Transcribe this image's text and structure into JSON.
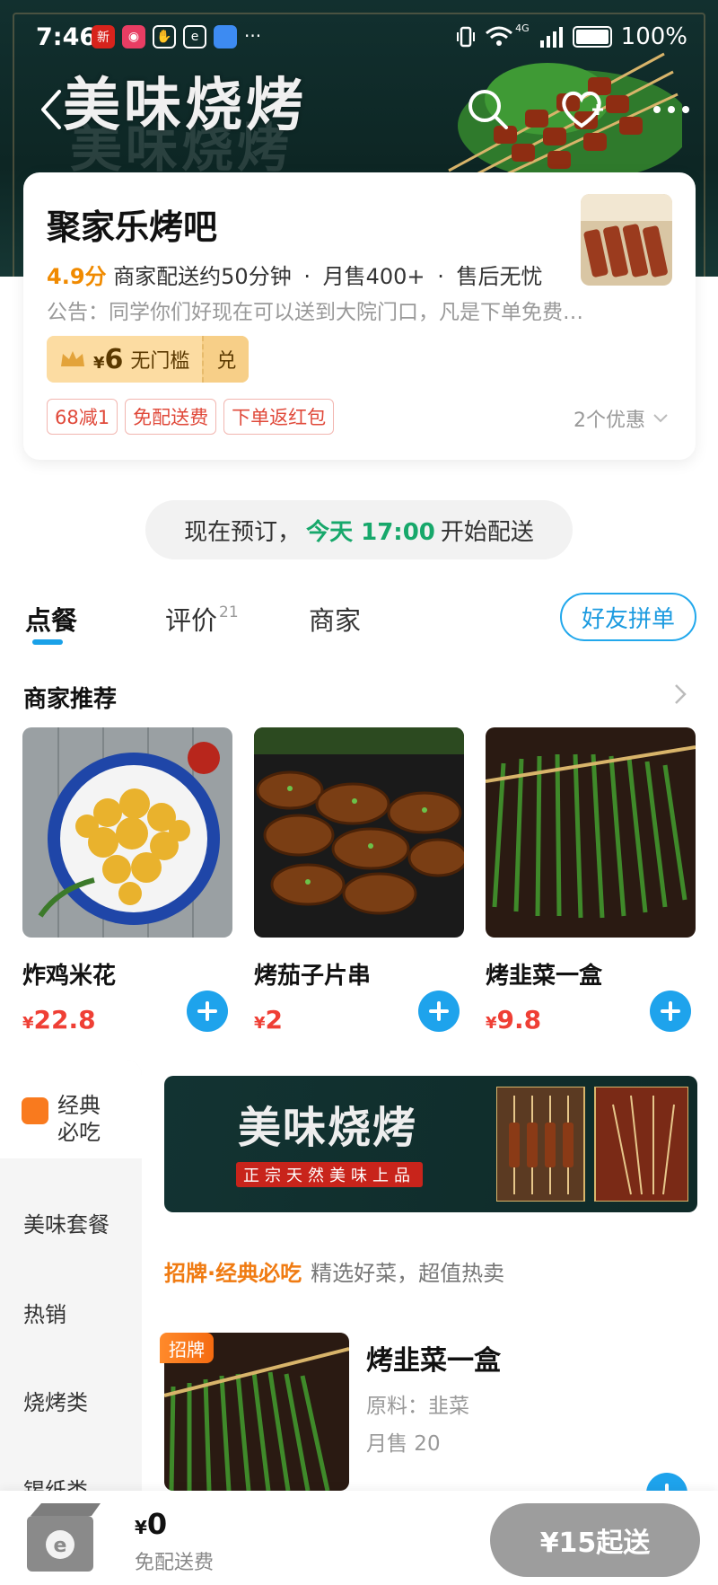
{
  "status_bar": {
    "time": "7:46",
    "battery_text": "100%",
    "battery_level": 1.0,
    "network_label": "4G",
    "more_dots": "···"
  },
  "header": {
    "banner_title": "美味烧烤",
    "icons": [
      "back-icon",
      "search-icon",
      "favorite-icon",
      "more-icon"
    ]
  },
  "shop": {
    "name": "聚家乐烤吧",
    "rating": "4.9分",
    "delivery_time": "商家配送约50分钟",
    "monthly_sales": "月售400+",
    "after_sale": "售后无忧",
    "separator": "·",
    "notice": "公告：同学你们好现在可以送到大院门口，凡是下单免费…",
    "coupon": {
      "currency": "¥",
      "amount": "6",
      "condition": "无门槛",
      "exchange": "兑"
    },
    "promos": [
      "68减1",
      "免配送费",
      "下单返红包"
    ],
    "promo_more": "2个优惠"
  },
  "preorder": {
    "prefix": "现在预订，",
    "highlight": "今天 17:00",
    "suffix": "开始配送"
  },
  "tabs": {
    "order": "点餐",
    "reviews": "评价",
    "reviews_count": "21",
    "merchant": "商家",
    "friend_order": "好友拼单"
  },
  "recommended": {
    "title": "商家推荐",
    "items": [
      {
        "name": "炸鸡米花",
        "currency": "¥",
        "price": "22.8"
      },
      {
        "name": "烤茄子片串",
        "currency": "¥",
        "price": "2"
      },
      {
        "name": "烤韭菜一盒",
        "currency": "¥",
        "price": "9.8"
      }
    ]
  },
  "sidebar": {
    "items": [
      {
        "label": "经典必吃"
      },
      {
        "label": "美味套餐"
      },
      {
        "label": "热销"
      },
      {
        "label": "烧烤类"
      },
      {
        "label": "锡纸类"
      }
    ]
  },
  "banner": {
    "title": "美味烧烤",
    "subtitle": "正宗天然美味上品"
  },
  "section": {
    "highlight": "招牌·经典必吃",
    "desc": "精选好菜，超值热卖"
  },
  "product": {
    "badge": "招牌",
    "name": "烤韭菜一盒",
    "ingredients": "原料：韭菜",
    "monthly_sales": "月售 20"
  },
  "cart": {
    "currency": "¥",
    "total": "0",
    "free_delivery": "免配送费",
    "min_order": "¥15起送"
  },
  "colors": {
    "accent_blue": "#1ea3ec",
    "price_red": "#ef3f35",
    "rating_orange": "#f08a00",
    "preorder_green": "#17a86b"
  }
}
